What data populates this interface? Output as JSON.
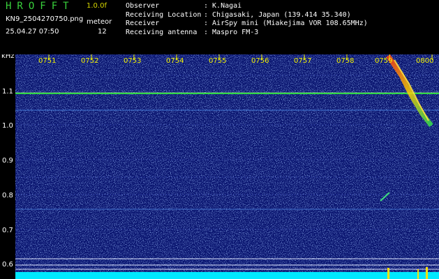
{
  "app": {
    "title": "HROFFT",
    "version": "1.0.0f",
    "filename": "KN9_2504270750.png",
    "datetime": "25.04.27 07:50",
    "meteor_label": "meteor",
    "meteor_count": "12"
  },
  "meta": [
    {
      "key": "Observer",
      "value": ": K.Nagai"
    },
    {
      "key": "Receiving Location",
      "value": ": Chigasaki, Japan (139.414 35.340)"
    },
    {
      "key": "Receiver",
      "value": ": AirSpy mini (Miakejima VOR 108.65MHz)"
    },
    {
      "key": "Receiving antenna",
      "value": ": Maspro FM-3"
    }
  ],
  "plot": {
    "y_unit": "kHz",
    "y_labels": [
      "1.1",
      "1.0",
      "0.9",
      "0.8",
      "0.7",
      "0.6"
    ],
    "time_labels": [
      "0751",
      "0752",
      "0753",
      "0754",
      "0755",
      "0756",
      "0757",
      "0758",
      "0759",
      "0800"
    ],
    "colors": {
      "background": "#0a1570",
      "carrier": "#32d848",
      "noise_bar": "#00e8ff",
      "time_label": "#f0f000"
    }
  }
}
